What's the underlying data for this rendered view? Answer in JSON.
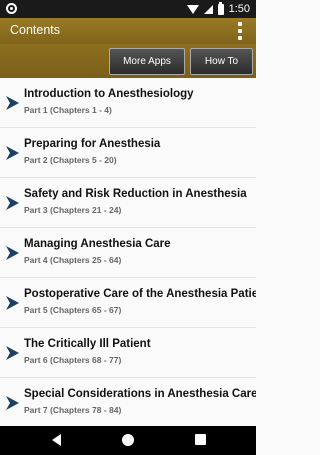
{
  "status_bar": {
    "time": "1:50"
  },
  "app_bar": {
    "title": "Contents",
    "overflow_icon": "more-vert-icon"
  },
  "toolbar": {
    "more_apps_label": "More Apps",
    "how_to_label": "How To"
  },
  "colors": {
    "app_bar": "#8c6d1f",
    "chevron": "#1c3f66"
  },
  "contents": [
    {
      "title": "Introduction to Anesthesiology",
      "subtitle": "Part 1 (Chapters 1 - 4)"
    },
    {
      "title": "Preparing for Anesthesia",
      "subtitle": "Part 2 (Chapters 5 - 20)"
    },
    {
      "title": "Safety and Risk Reduction in Anesthesia",
      "subtitle": "Part 3 (Chapters 21 - 24)"
    },
    {
      "title": "Managing Anesthesia Care",
      "subtitle": "Part 4 (Chapters 25 - 64)"
    },
    {
      "title": "Postoperative Care of the Anesthesia Patient",
      "subtitle": "Part 5 (Chapters 65 - 67)"
    },
    {
      "title": "The Critically Ill Patient",
      "subtitle": "Part 6 (Chapters 68 - 77)"
    },
    {
      "title": "Special Considerations in Anesthesia Care",
      "subtitle": "Part 7 (Chapters 78 - 84)"
    }
  ]
}
